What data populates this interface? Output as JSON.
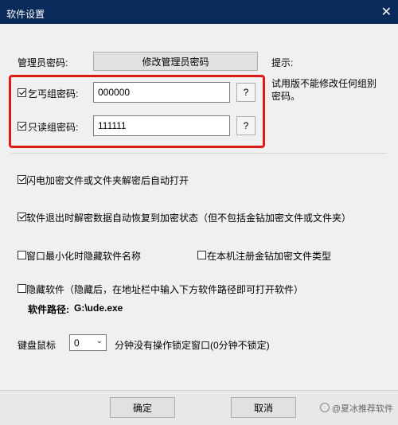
{
  "window": {
    "title": "软件设置",
    "close_glyph": "✕"
  },
  "admin": {
    "label": "管理员密码:",
    "button": "修改管理员密码"
  },
  "hint": {
    "label": "提示:",
    "text_line1": "试用版不能修改任何组别",
    "text_line2": "密码。"
  },
  "groups": [
    {
      "label": "乞丐组密码:",
      "checked": true,
      "value": "000000",
      "help": "?"
    },
    {
      "label": "只读组密码:",
      "checked": true,
      "value": "111111",
      "help": "?"
    }
  ],
  "options": {
    "flash_auto_open": {
      "label": "闪电加密文件或文件夹解密后自动打开",
      "checked": true
    },
    "restore_on_exit": {
      "label": "软件退出时解密数据自动恢复到加密状态（但不包括金钻加密文件或文件夹）",
      "checked": true
    },
    "hide_name_minimized": {
      "label": "窗口最小化时隐藏软件名称",
      "checked": false
    },
    "register_type": {
      "label": "在本机注册金钻加密文件类型",
      "checked": false
    },
    "hide_software": {
      "label": "隐藏软件（隐藏后，在地址栏中输入下方软件路径即可打开软件）",
      "checked": false
    }
  },
  "software_path": {
    "label": "软件路径:",
    "value": "G:\\ude.exe"
  },
  "lock": {
    "label": "键盘鼠标",
    "selected": "0",
    "suffix": "分钟没有操作锁定窗口(0分钟不锁定)"
  },
  "footer": {
    "ok": "确定",
    "cancel": "取消"
  },
  "watermark": "@夏冰推荐软件",
  "accent_colors": {
    "titlebar": "#0b2a5c",
    "highlight_box": "#e01818"
  }
}
